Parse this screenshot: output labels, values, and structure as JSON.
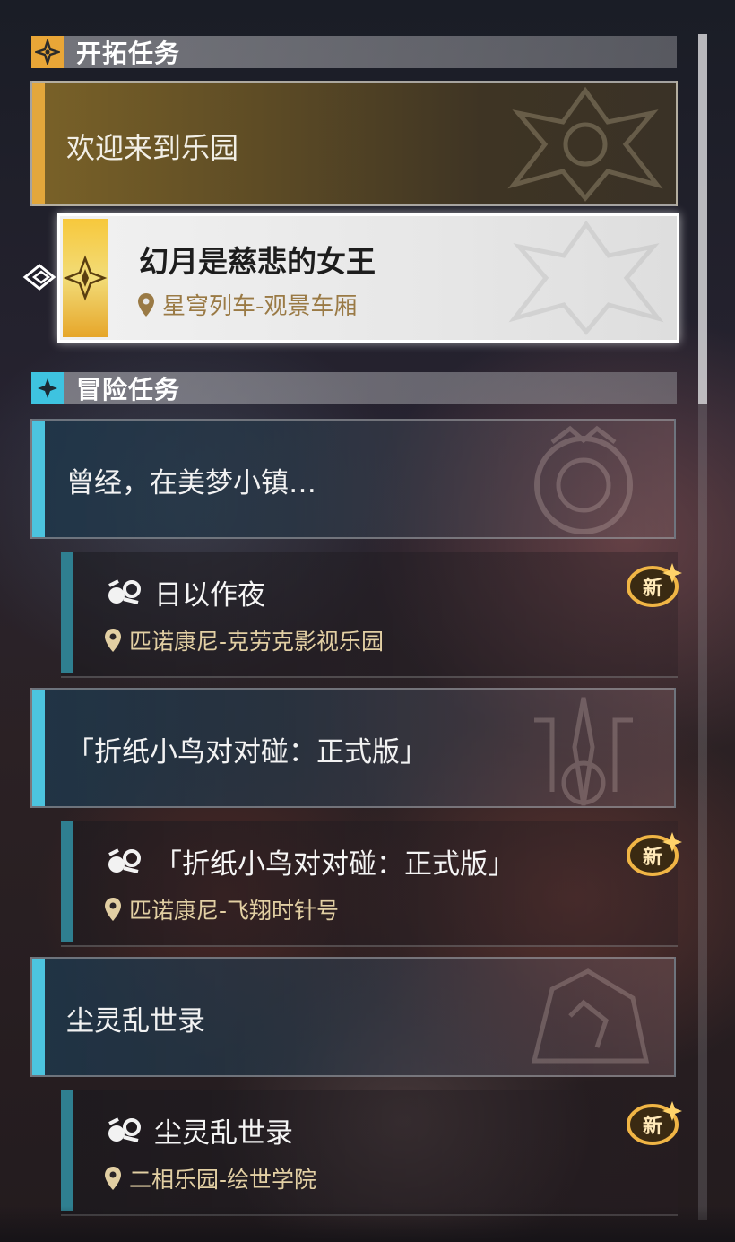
{
  "sections": {
    "trailblaze": {
      "title": "开拓任务",
      "icon": "trailblaze-diamond-icon",
      "accent": "#e9a637",
      "parent": {
        "title": "欢迎来到乐园"
      },
      "child": {
        "title": "幻月是慈悲的女王",
        "location": "星穹列车-观景车厢"
      }
    },
    "adventure": {
      "title": "冒险任务",
      "icon": "adventure-star-icon",
      "accent": "#3ec3e0",
      "groups": [
        {
          "title": "曾经，在美梦小镇…",
          "mission": {
            "title": "日以作夜",
            "location": "匹诺康尼-克劳克影视乐园",
            "badge": "新"
          }
        },
        {
          "title": "「折纸小鸟对对碰：正式版」",
          "mission": {
            "title": "「折纸小鸟对对碰：正式版」",
            "location": "匹诺康尼-飞翔时针号",
            "badge": "新"
          }
        },
        {
          "title": "尘灵乱世录",
          "mission": {
            "title": "尘灵乱世录",
            "location": "二相乐园-绘世学院",
            "badge": "新"
          }
        }
      ]
    }
  },
  "colors": {
    "trailblaze_gold": "#e3a73b",
    "adventure_blue": "#4cc4df",
    "location_gold": "#e2cfa3"
  }
}
